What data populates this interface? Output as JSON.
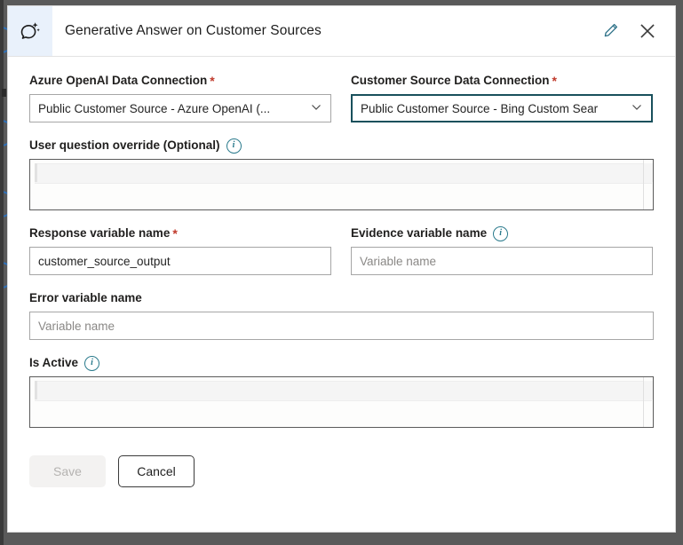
{
  "dialog": {
    "title": "Generative Answer on Customer Sources",
    "icon": "sparkle-chat-icon",
    "edit_icon": "pencil-icon",
    "close_icon": "close-icon"
  },
  "fields": {
    "azure_connection": {
      "label": "Azure OpenAI Data Connection",
      "required": "*",
      "value": "Public Customer Source - Azure OpenAI (...",
      "chevron": "chevron-down-icon"
    },
    "customer_source_connection": {
      "label": "Customer Source Data Connection",
      "required": "*",
      "value": "Public Customer Source - Bing Custom Sear",
      "chevron": "chevron-down-icon"
    },
    "user_question_override": {
      "label": "User question override (Optional)",
      "info": "i",
      "value": ""
    },
    "response_variable": {
      "label": "Response variable name",
      "required": "*",
      "value": "customer_source_output",
      "placeholder": "Variable name"
    },
    "evidence_variable": {
      "label": "Evidence variable name",
      "info": "i",
      "value": "",
      "placeholder": "Variable name"
    },
    "error_variable": {
      "label": "Error variable name",
      "value": "",
      "placeholder": "Variable name"
    },
    "is_active": {
      "label": "Is Active",
      "info": "i",
      "value": ""
    }
  },
  "footer": {
    "save_label": "Save",
    "cancel_label": "Cancel"
  },
  "colors": {
    "accent_teal": "#2a7a8c",
    "focus_border": "#19505c",
    "required_red": "#c0392b",
    "icon_tile_bg": "#e9f1fb",
    "backdrop": "#5a5a5a"
  }
}
